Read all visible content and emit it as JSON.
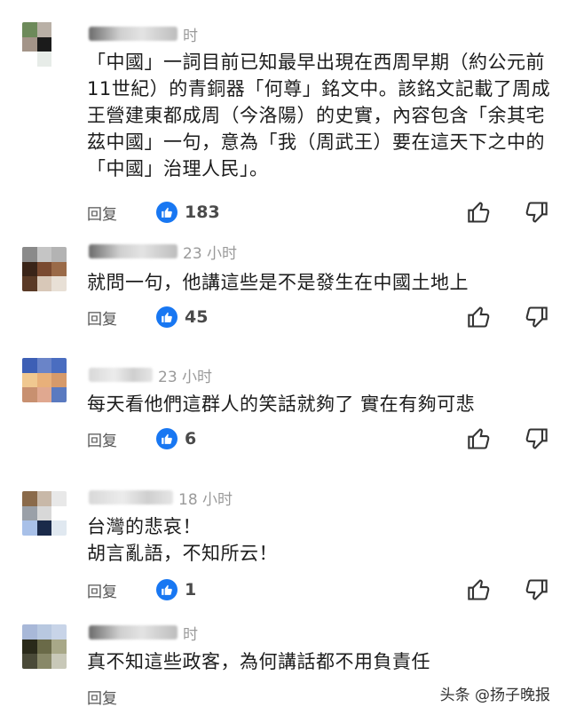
{
  "comments": [
    {
      "time": "时",
      "text": "「中國」一詞目前已知最早出現在西周早期（約公元前11世紀）的青銅器「何尊」銘文中。該銘文記載了周成王營建東都成周（今洛陽）的史實，內容包含「余其宅茲中國」一句，意為「我（周武王）要在這天下之中的「中國」治理人民」。",
      "reply": "回复",
      "likes": "183"
    },
    {
      "time": "23 小时",
      "text": "就問一句，他講這些是不是發生在中國土地上",
      "reply": "回复",
      "likes": "45"
    },
    {
      "time": "23 小时",
      "text": "每天看他們這群人的笑話就夠了 實在有夠可悲",
      "reply": "回复",
      "likes": "6"
    },
    {
      "time": "18 小时",
      "text": "台灣的悲哀！\n胡言亂語，不知所云！",
      "reply": "回复",
      "likes": "1"
    },
    {
      "time": "时",
      "text": "真不知這些政客，為何講話都不用負責任",
      "reply": "回复",
      "likes": ""
    }
  ],
  "watermark": "头条 @扬子晚报",
  "colors": {
    "like_badge": "#1877f2",
    "meta_gray": "#9a9a9a"
  },
  "icons": {
    "like_badge": "thumbs-up-filled-icon",
    "like": "thumbs-up-outline-icon",
    "dislike": "thumbs-down-outline-icon"
  }
}
